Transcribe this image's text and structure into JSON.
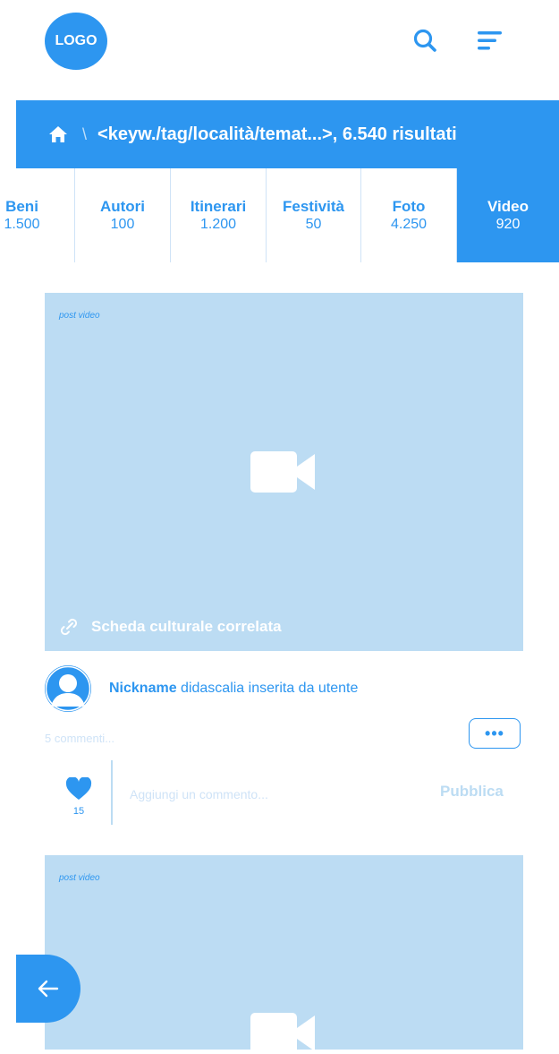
{
  "header": {
    "logo_text": "LOGO",
    "search_icon": "search-icon",
    "menu_icon": "menu-icon"
  },
  "breadcrumb": {
    "home_icon": "home-icon",
    "separator": "\\",
    "text": "<keyw./tag/località/temat...>, 6.540 risultati"
  },
  "tabs": [
    {
      "label": "Beni",
      "count": "1.500",
      "active": false
    },
    {
      "label": "Autori",
      "count": "100",
      "active": false
    },
    {
      "label": "Itinerari",
      "count": "1.200",
      "active": false
    },
    {
      "label": "Festività",
      "count": "50",
      "active": false
    },
    {
      "label": "Foto",
      "count": "4.250",
      "active": false
    },
    {
      "label": "Video",
      "count": "920",
      "active": true
    }
  ],
  "posts": [
    {
      "tag": "post video",
      "related_label": "Scheda culturale correlata",
      "nickname": "Nickname",
      "caption": "didascalia inserita da utente",
      "comments_link": "5 commenti...",
      "more_label": "•••",
      "likes": "15",
      "comment_placeholder": "Aggiungi un commento...",
      "publish_label": "Pubblica"
    },
    {
      "tag": "post video"
    }
  ],
  "colors": {
    "accent": "#2d96f0",
    "media_bg": "#bcdcf3",
    "muted": "#cfe3f7"
  }
}
